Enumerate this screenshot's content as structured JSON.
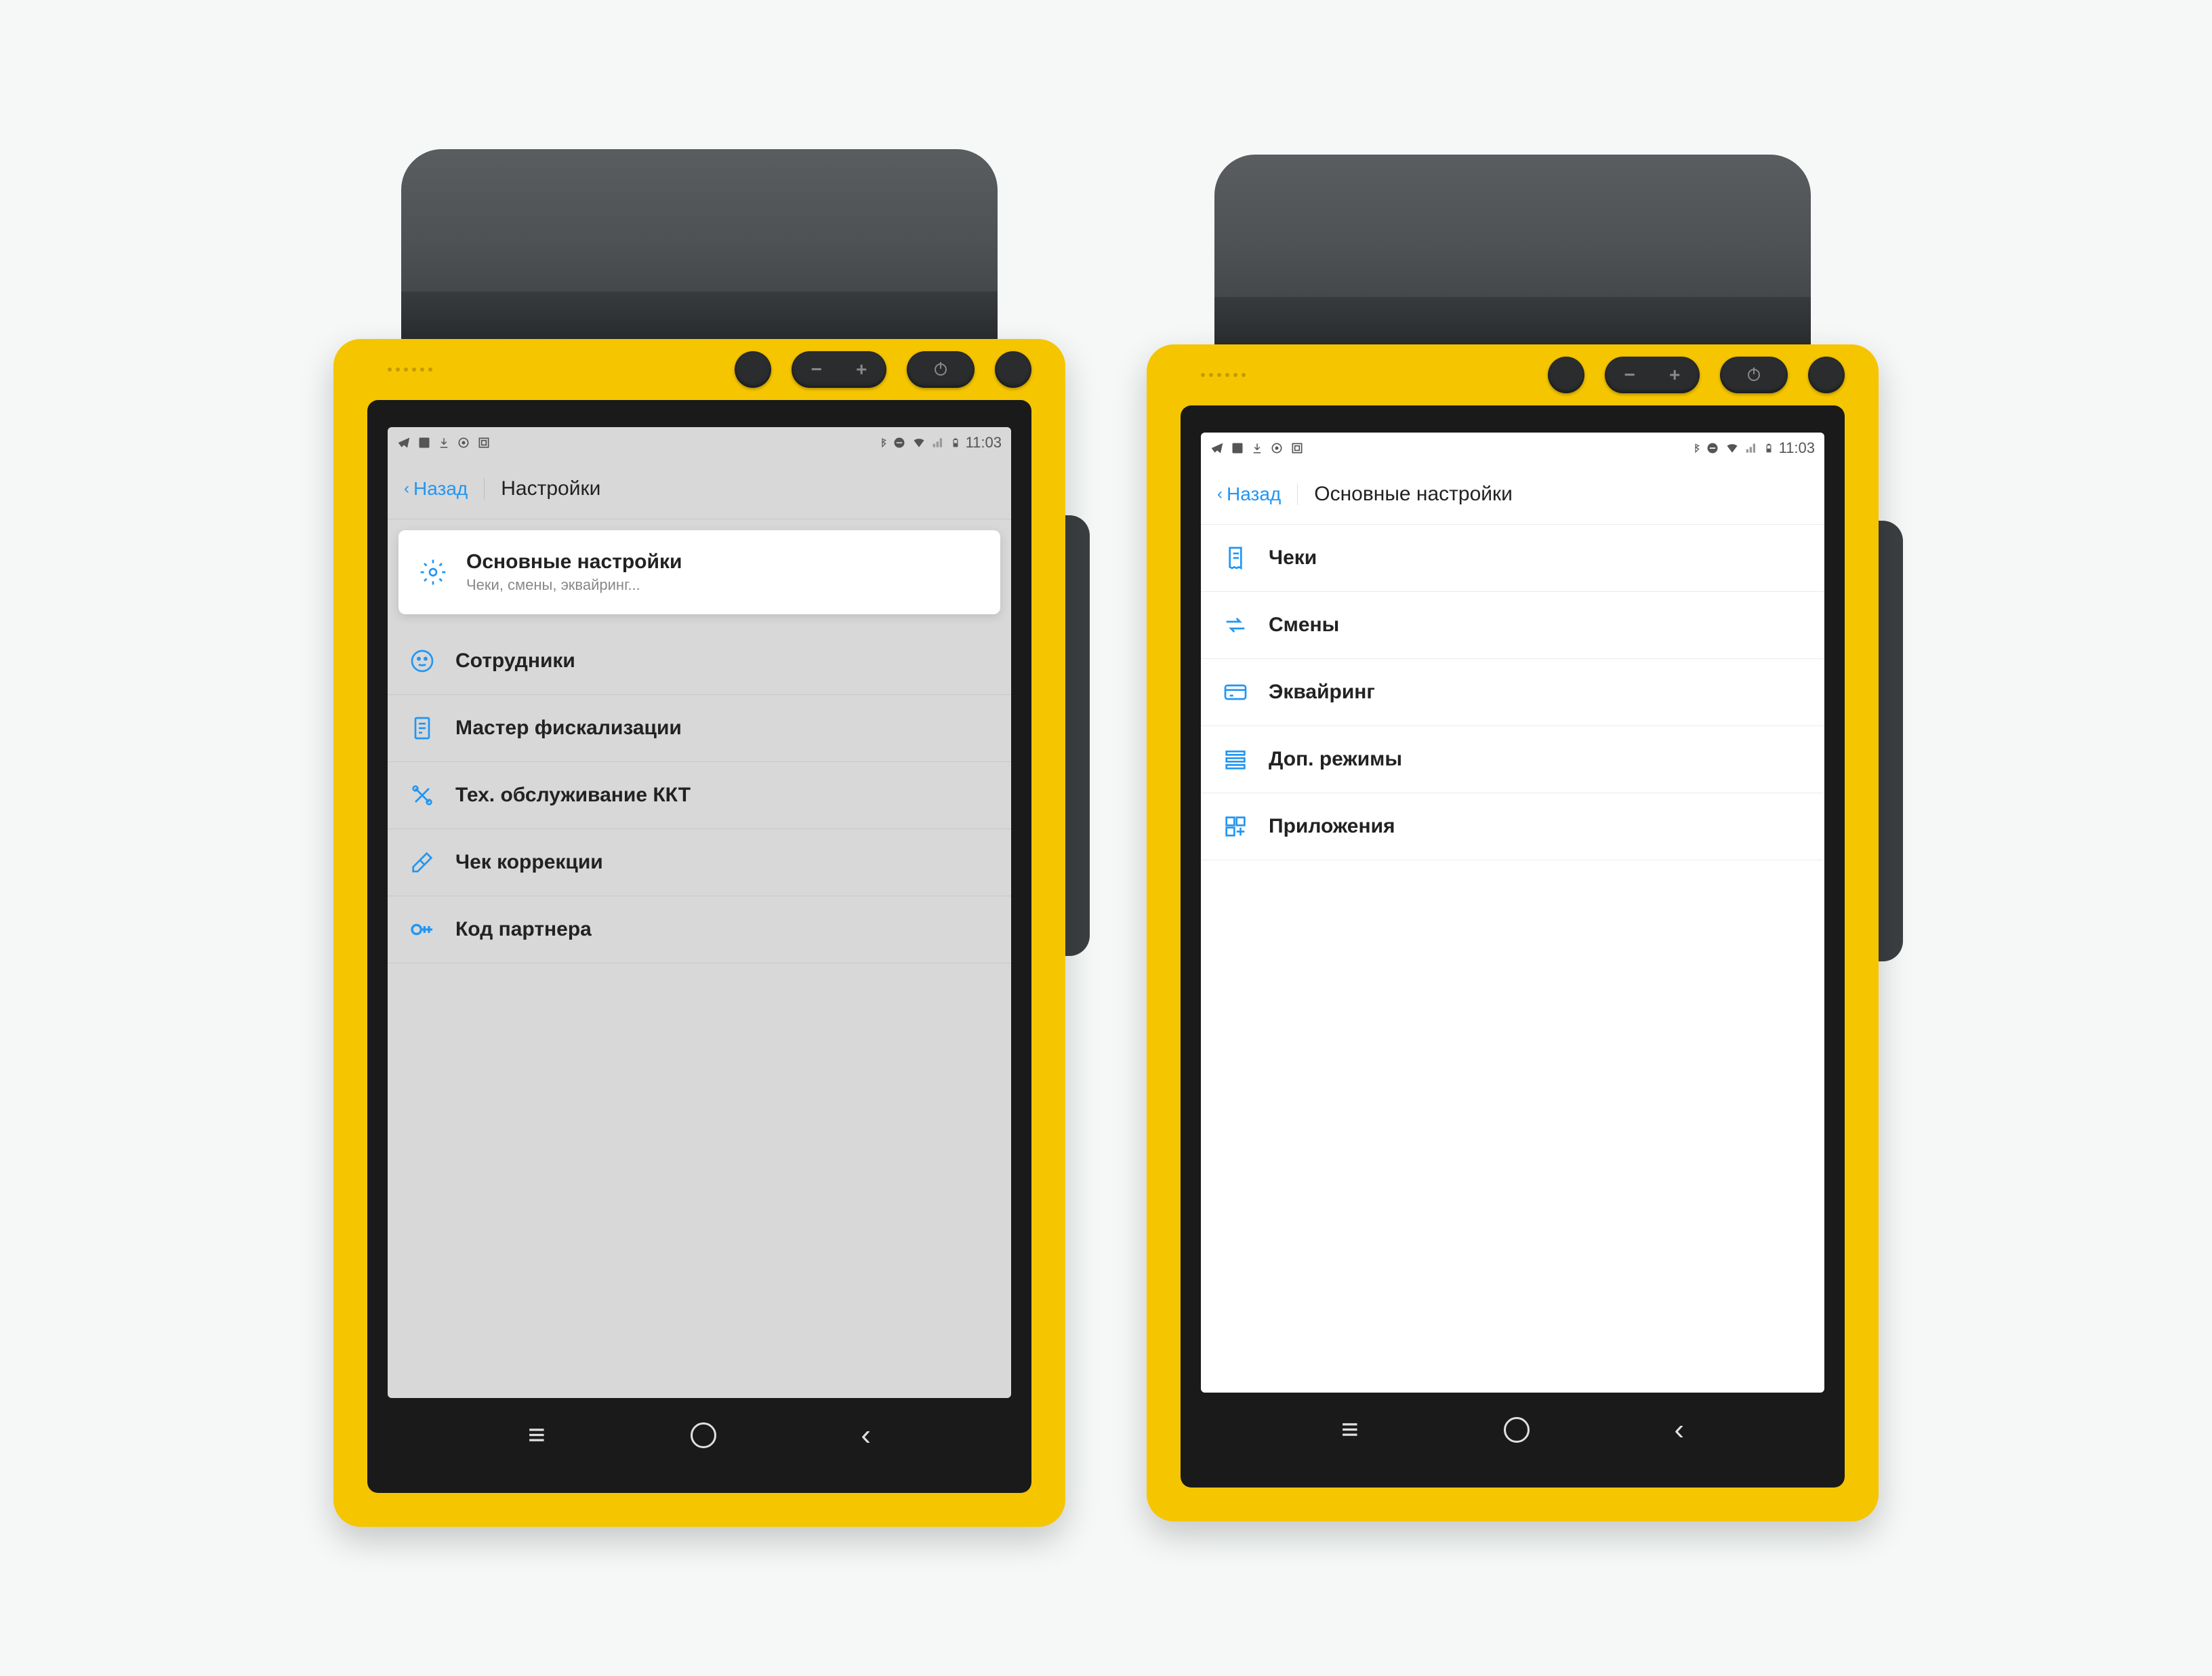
{
  "status": {
    "time": "11:03"
  },
  "screen1": {
    "back_label": "Назад",
    "title": "Настройки",
    "items": [
      {
        "title": "Основные настройки",
        "sub": "Чеки, смены, эквайринг...",
        "icon": "gear-icon"
      },
      {
        "title": "Сотрудники",
        "icon": "employee-icon"
      },
      {
        "title": "Мастер фискализации",
        "icon": "fiscal-icon"
      },
      {
        "title": "Тех. обслуживание ККТ",
        "icon": "tools-icon"
      },
      {
        "title": "Чек коррекции",
        "icon": "eraser-icon"
      },
      {
        "title": "Код партнера",
        "icon": "key-icon"
      }
    ]
  },
  "screen2": {
    "back_label": "Назад",
    "title": "Основные настройки",
    "items": [
      {
        "title": "Чеки",
        "icon": "receipt-icon"
      },
      {
        "title": "Смены",
        "icon": "shifts-icon"
      },
      {
        "title": "Эквайринг",
        "icon": "card-icon"
      },
      {
        "title": "Доп. режимы",
        "icon": "modes-icon"
      },
      {
        "title": "Приложения",
        "icon": "apps-icon"
      }
    ]
  },
  "accent": "#2196f3"
}
